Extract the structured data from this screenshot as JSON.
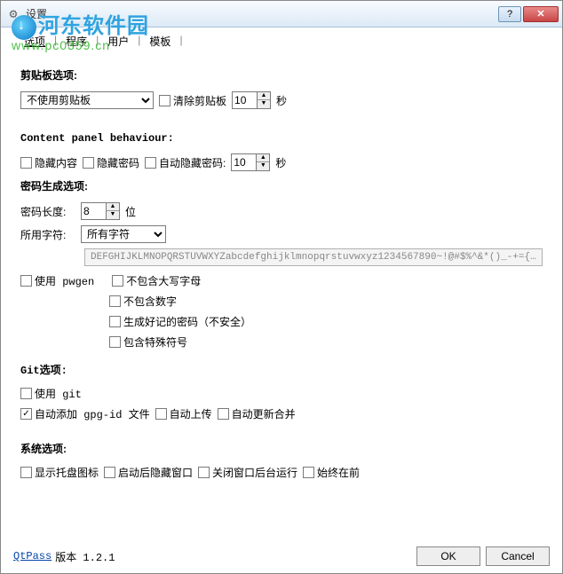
{
  "window": {
    "title": "设置",
    "help": "?",
    "close": "✕"
  },
  "watermark": {
    "line1": "河东软件园",
    "line2": "www.pc0359.cn"
  },
  "tabs": {
    "items": [
      "选项",
      "程序",
      "用户",
      "模板"
    ],
    "active": 0
  },
  "clipboard": {
    "title": "剪贴板选项:",
    "mode": "不使用剪贴板",
    "clear_label": "清除剪贴板",
    "timeout": "10",
    "sec": "秒"
  },
  "panel": {
    "title": "Content panel behaviour:",
    "hide_content": "隐藏内容",
    "hide_password": "隐藏密码",
    "auto_hide": "自动隐藏密码:",
    "timeout": "10",
    "sec": "秒"
  },
  "pwgen": {
    "title": "密码生成选项:",
    "len_label": "密码长度:",
    "len_value": "8",
    "len_unit": "位",
    "chars_label": "所用字符:",
    "chars_select": "所有字符",
    "chars_display": "DEFGHIJKLMNOPQRSTUVWXYZabcdefghijklmnopqrstuvwxyz1234567890~!@#$%^&*()_-+={}[]|:;<>,.?",
    "use_pwgen": "使用 pwgen",
    "no_upper": "不包含大写字母",
    "no_digit": "不包含数字",
    "memorable": "生成好记的密码（不安全）",
    "special": "包含特殊符号"
  },
  "git": {
    "title": "Git选项:",
    "use_git": "使用 git",
    "auto_add_gpgid": "自动添加 gpg-id 文件",
    "auto_add_gpgid_checked": true,
    "auto_push": "自动上传",
    "auto_pull": "自动更新合并"
  },
  "sys": {
    "title": "系统选项:",
    "tray": "显示托盘图标",
    "start_hidden": "启动后隐藏窗口",
    "close_bg": "关闭窗口后台运行",
    "always_top": "始终在前"
  },
  "footer": {
    "link": "QtPass",
    "version": "版本 1.2.1",
    "ok": "OK",
    "cancel": "Cancel"
  }
}
